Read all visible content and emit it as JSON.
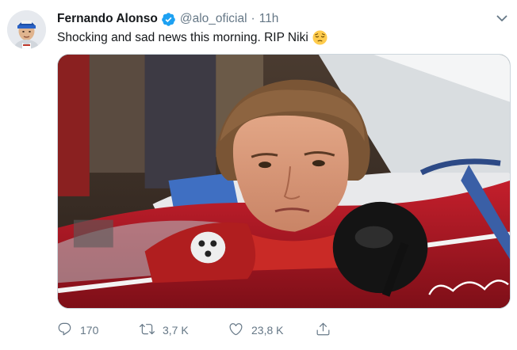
{
  "author": {
    "name": "Fernando Alonso",
    "handle": "@alo_oficial",
    "separator": "·",
    "time": "11h"
  },
  "tweet": {
    "text": "Shocking and sad news this morning. RIP Niki",
    "emoji": "pensive-face"
  },
  "actions": {
    "replies": "170",
    "retweets": "3,7 K",
    "likes": "23,8 K"
  },
  "icons": {
    "verified": "verified-badge-icon",
    "chevron": "chevron-down-icon",
    "reply": "reply-icon",
    "retweet": "retweet-icon",
    "like": "heart-icon",
    "share": "share-icon"
  },
  "colors": {
    "accent": "#1da1f2",
    "secondary_text": "#657786",
    "primary_text": "#14171a"
  }
}
